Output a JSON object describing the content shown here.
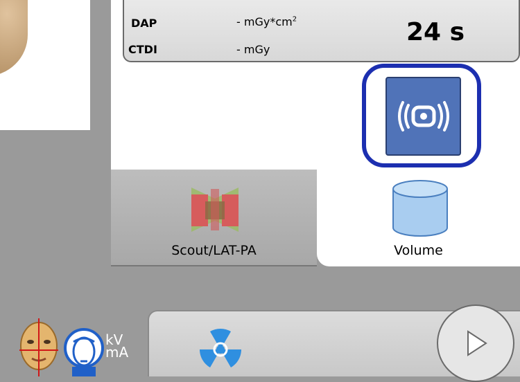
{
  "dose": {
    "dap_label": "DAP",
    "dap_value": "- mGy*cm",
    "dap_unit_exp": "2",
    "ctdi_label": "CTDI",
    "ctdi_value": "- mGy"
  },
  "time": "24 s",
  "tabs": [
    {
      "label": "Scout/LAT-PA",
      "icon": "scout-lat-pa-icon"
    },
    {
      "label": "Volume",
      "icon": "cylinder-icon"
    }
  ],
  "volume_mode_button": {
    "icon": "volume-scan-icon"
  },
  "bottom": {
    "kv_label": "kV",
    "ma_label": "mA",
    "icons": [
      "patient-face-icon",
      "patient-head-outline-icon",
      "radiation-icon",
      "play-icon"
    ]
  },
  "colors": {
    "selection_ring": "#1c2fb0",
    "mode_button": "#5073b8"
  }
}
